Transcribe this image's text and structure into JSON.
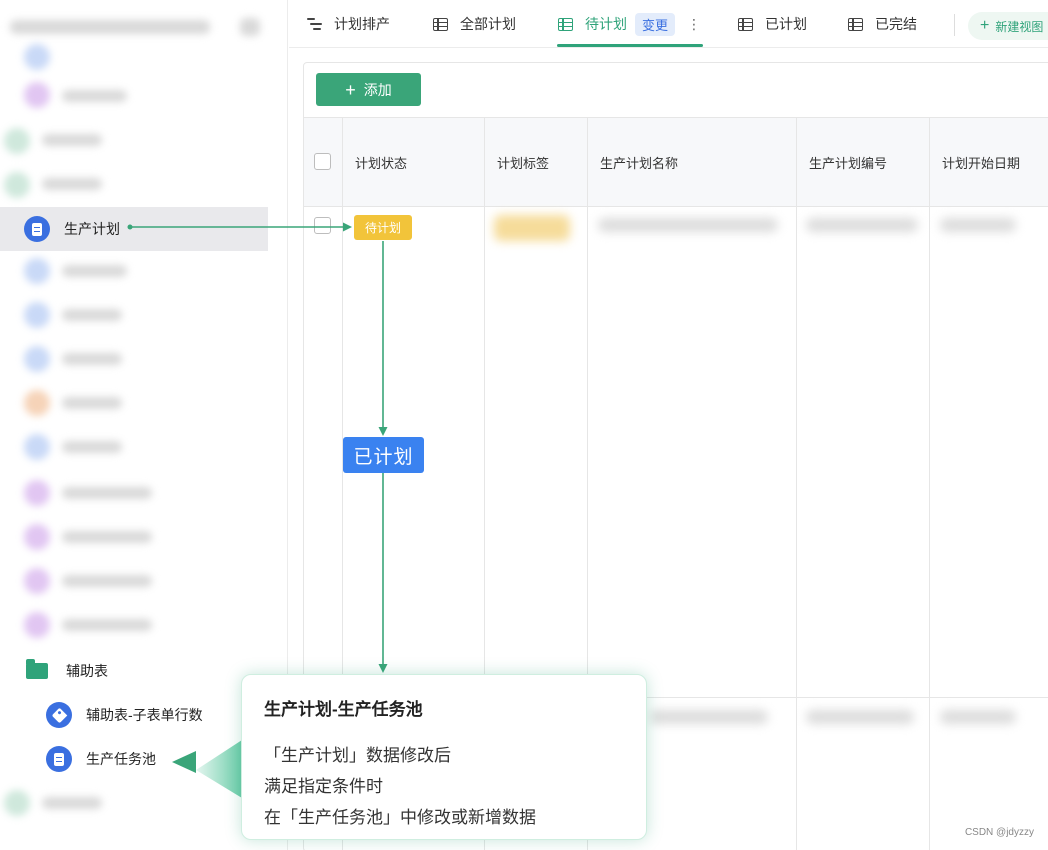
{
  "sidebar": {
    "selected_label": "生产计划",
    "folder_label": "辅助表",
    "sub_items": [
      {
        "label": "辅助表-子表单行数",
        "icon": "tag-icon"
      },
      {
        "label": "生产任务池",
        "icon": "document-icon"
      }
    ]
  },
  "tabs": {
    "gantt": "计划排产",
    "all": "全部计划",
    "pending": "待计划",
    "pending_badge": "变更",
    "planned": "已计划",
    "done": "已完结",
    "new_view": "新建视图"
  },
  "toolbar": {
    "add_label": "添加"
  },
  "table": {
    "headers": [
      "计划状态",
      "计划标签",
      "生产计划名称",
      "生产计划编号",
      "计划开始日期"
    ],
    "rows": [
      {
        "status": "待计划"
      }
    ]
  },
  "annotation": {
    "planned_label": "已计划",
    "callout_title": "生产计划-生产任务池",
    "callout_lines": [
      "「生产计划」数据修改后",
      "满足指定条件时",
      "在「生产任务池」中修改或新增数据"
    ]
  },
  "watermark": "CSDN @jdyzzy",
  "colors": {
    "accent": "#2fa37a",
    "primary_blue": "#3a82f0",
    "status_pending": "#f2c43a"
  }
}
